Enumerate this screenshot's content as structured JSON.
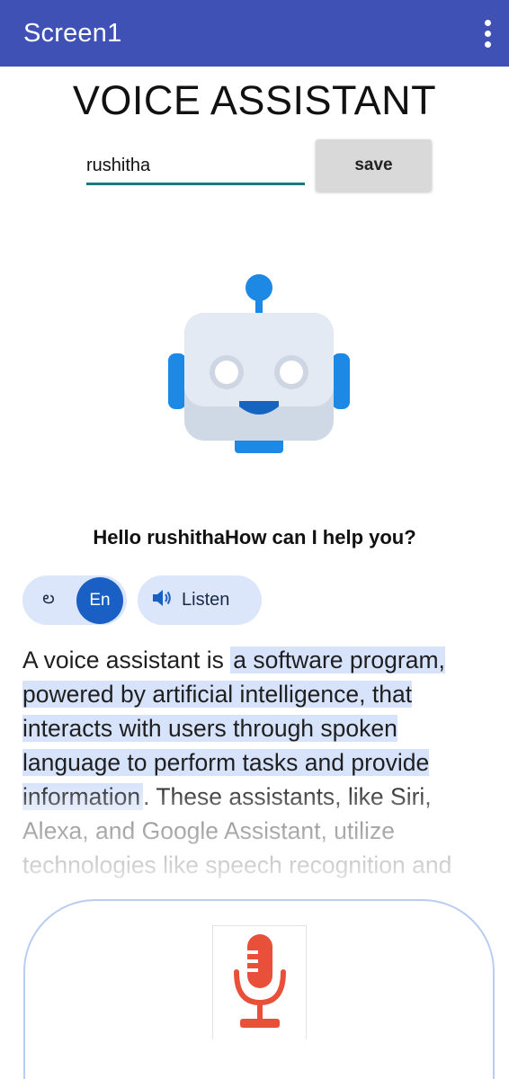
{
  "appbar": {
    "title": "Screen1",
    "menu_icon": "more-vert-icon"
  },
  "heading": "VOICE ASSISTANT",
  "name_input": {
    "value": "rushitha"
  },
  "save_label": "save",
  "robot_icon": "robot-icon",
  "greeting": "Hello rushithaHow can I help you?",
  "language": {
    "te_label": "ల",
    "en_label": "En",
    "selected": "En"
  },
  "listen": {
    "label": "Listen",
    "icon": "speaker-icon"
  },
  "paragraph": {
    "part1": "A voice assistant is ",
    "highlight": "a software program, powered by artificial intelligence, that interacts with users through spoken language to perform tasks and provide information",
    "part2": ". These assistants, like Siri, Alexa, and Google Assistant, utilize technologies like speech recognition and"
  },
  "mic_icon": "microphone-icon",
  "colors": {
    "appbar": "#3f51b5",
    "accent_blue": "#1a5fc4",
    "pill_bg": "#dbe6fb",
    "mic_red": "#e8503a",
    "robot_blue": "#1e88e5"
  }
}
